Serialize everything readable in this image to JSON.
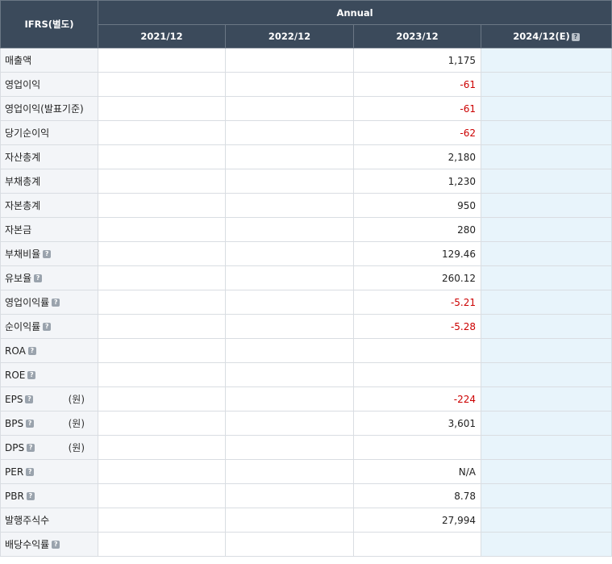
{
  "header": {
    "corner": "IFRS(별도)",
    "group": "Annual",
    "periods": [
      "2021/12",
      "2022/12",
      "2023/12",
      "2024/12(E)"
    ]
  },
  "rows": [
    {
      "label": "매출액",
      "help": false,
      "unit": "",
      "values": [
        "",
        "",
        "1,175",
        ""
      ]
    },
    {
      "label": "영업이익",
      "help": false,
      "unit": "",
      "values": [
        "",
        "",
        "-61",
        ""
      ]
    },
    {
      "label": "영업이익(발표기준)",
      "help": false,
      "unit": "",
      "values": [
        "",
        "",
        "-61",
        ""
      ]
    },
    {
      "label": "당기순이익",
      "help": false,
      "unit": "",
      "values": [
        "",
        "",
        "-62",
        ""
      ]
    },
    {
      "label": "자산총계",
      "help": false,
      "unit": "",
      "values": [
        "",
        "",
        "2,180",
        ""
      ]
    },
    {
      "label": "부채총계",
      "help": false,
      "unit": "",
      "values": [
        "",
        "",
        "1,230",
        ""
      ]
    },
    {
      "label": "자본총계",
      "help": false,
      "unit": "",
      "values": [
        "",
        "",
        "950",
        ""
      ]
    },
    {
      "label": "자본금",
      "help": false,
      "unit": "",
      "values": [
        "",
        "",
        "280",
        ""
      ]
    },
    {
      "label": "부채비율",
      "help": true,
      "unit": "",
      "values": [
        "",
        "",
        "129.46",
        ""
      ]
    },
    {
      "label": "유보율",
      "help": true,
      "unit": "",
      "values": [
        "",
        "",
        "260.12",
        ""
      ]
    },
    {
      "label": "영업이익률",
      "help": true,
      "unit": "",
      "values": [
        "",
        "",
        "-5.21",
        ""
      ]
    },
    {
      "label": "순이익률",
      "help": true,
      "unit": "",
      "values": [
        "",
        "",
        "-5.28",
        ""
      ]
    },
    {
      "label": "ROA",
      "help": true,
      "unit": "",
      "values": [
        "",
        "",
        "",
        ""
      ]
    },
    {
      "label": "ROE",
      "help": true,
      "unit": "",
      "values": [
        "",
        "",
        "",
        ""
      ]
    },
    {
      "label": "EPS",
      "help": true,
      "unit": "(원)",
      "values": [
        "",
        "",
        "-224",
        ""
      ]
    },
    {
      "label": "BPS",
      "help": true,
      "unit": "(원)",
      "values": [
        "",
        "",
        "3,601",
        ""
      ]
    },
    {
      "label": "DPS",
      "help": true,
      "unit": "(원)",
      "values": [
        "",
        "",
        "",
        ""
      ]
    },
    {
      "label": "PER",
      "help": true,
      "unit": "",
      "values": [
        "",
        "",
        "N/A",
        ""
      ]
    },
    {
      "label": "PBR",
      "help": true,
      "unit": "",
      "values": [
        "",
        "",
        "8.78",
        ""
      ]
    },
    {
      "label": "발행주식수",
      "help": false,
      "unit": "",
      "values": [
        "",
        "",
        "27,994",
        ""
      ]
    },
    {
      "label": "배당수익률",
      "help": true,
      "unit": "",
      "values": [
        "",
        "",
        "",
        ""
      ]
    }
  ],
  "help_glyph": "?",
  "colors": {
    "header_bg": "#3b4a5b",
    "label_bg": "#f3f5f8",
    "estimate_bg": "#e8f4fb",
    "negative": "#cc0000"
  }
}
